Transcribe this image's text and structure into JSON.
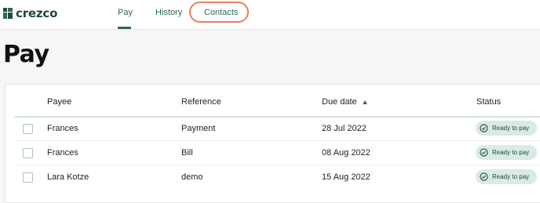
{
  "brand": {
    "name": "crezco",
    "accent": "#2d6a55",
    "logo_icon": "crezco-logo-icon"
  },
  "nav": {
    "tabs": [
      {
        "label": "Pay",
        "active": true
      },
      {
        "label": "History",
        "active": false
      },
      {
        "label": "Contacts",
        "active": false,
        "highlighted": true
      }
    ]
  },
  "page": {
    "title": "Pay"
  },
  "table": {
    "columns": {
      "payee": "Payee",
      "reference": "Reference",
      "due_date": "Due date",
      "status": "Status"
    },
    "sort": {
      "column": "due_date",
      "direction": "ascending",
      "icon": "sort-ascending-icon"
    },
    "rows": [
      {
        "payee": "Frances",
        "reference": "Payment",
        "due_date": "28 Jul 2022",
        "status": "Ready to pay",
        "checked": false
      },
      {
        "payee": "Frances",
        "reference": "Bill",
        "due_date": "08 Aug 2022",
        "status": "Ready to pay",
        "checked": false
      },
      {
        "payee": "Lara Kotze",
        "reference": "demo",
        "due_date": "15 Aug 2022",
        "status": "Ready to pay",
        "checked": false
      }
    ]
  },
  "colors": {
    "highlight_ring": "#e8805e",
    "status_badge_bg": "#d9ebe3"
  }
}
